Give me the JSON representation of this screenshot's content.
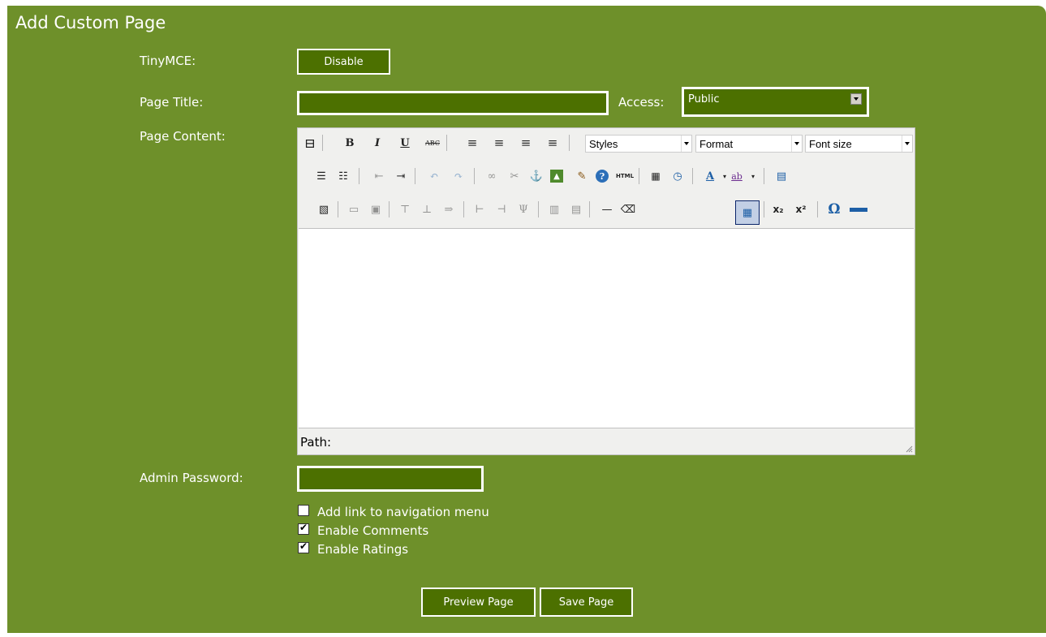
{
  "page_title": "Add Custom Page",
  "form": {
    "tinymce_label": "TinyMCE:",
    "tinymce_button": "Disable",
    "page_title_label": "Page Title:",
    "page_title_value": "",
    "access_label": "Access:",
    "access_value": "Public",
    "page_content_label": "Page Content:",
    "admin_password_label": "Admin Password:",
    "admin_password_value": ""
  },
  "editor": {
    "styles_select": "Styles",
    "format_select": "Format",
    "fontsize_select": "Font size",
    "path_label": "Path:",
    "icons": {
      "bold": "B",
      "italic": "I",
      "underline": "U",
      "strike": "ABC",
      "anchor": "⚓",
      "help": "?",
      "html": "HTML",
      "textcolor": "A",
      "bgcolor": "ab",
      "hr": "—",
      "sub": "x₂",
      "sup": "x²",
      "charmap": "Ω"
    }
  },
  "options": [
    {
      "label": "Add link to navigation menu",
      "checked": false
    },
    {
      "label": "Enable Comments",
      "checked": true
    },
    {
      "label": "Enable Ratings",
      "checked": true
    }
  ],
  "buttons": {
    "preview": "Preview Page",
    "save": "Save Page"
  },
  "colors": {
    "panel": "#6e902a",
    "field": "#4c7000"
  }
}
